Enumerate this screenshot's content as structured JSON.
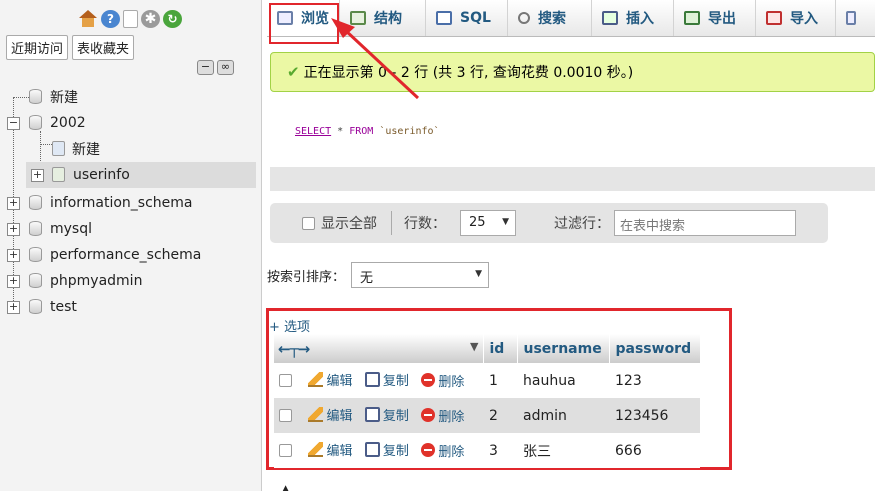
{
  "nav": {
    "recent_tab": "近期访问",
    "favorites_tab": "表收藏夹",
    "tree": {
      "new_root": "新建",
      "db_2002": "2002",
      "db_2002_new": "新建",
      "db_2002_table": "userinfo",
      "dbs": [
        "information_schema",
        "mysql",
        "performance_schema",
        "phpmyadmin",
        "test"
      ]
    }
  },
  "tabs": {
    "browse": "浏览",
    "structure": "结构",
    "sql": "SQL",
    "search": "搜索",
    "insert": "插入",
    "export": "导出",
    "import": "导入"
  },
  "success_message": "正在显示第 0 - 2 行 (共 3 行, 查询花费 0.0010 秒。)",
  "sql": {
    "select": "SELECT",
    "star": "*",
    "from": "FROM",
    "table": "`userinfo`"
  },
  "navbar": {
    "show_all": "显示全部",
    "rows_label": "行数：",
    "rows_value": "25",
    "filter_label": "过滤行：",
    "filter_placeholder": "在表中搜索"
  },
  "sort": {
    "label": "按索引排序：",
    "value": "无"
  },
  "results": {
    "options_link": "+ 选项",
    "columns": [
      "id",
      "username",
      "password"
    ],
    "actions": {
      "edit": "编辑",
      "copy": "复制",
      "delete": "删除"
    },
    "rows": [
      {
        "id": "1",
        "username": "hauhua",
        "password": "123"
      },
      {
        "id": "2",
        "username": "admin",
        "password": "123456"
      },
      {
        "id": "3",
        "username": "张三",
        "password": "666"
      }
    ]
  },
  "colors": {
    "accent_link": "#235a81",
    "highlight_red": "#e1262c",
    "success_bg": "#ebf8a4"
  }
}
